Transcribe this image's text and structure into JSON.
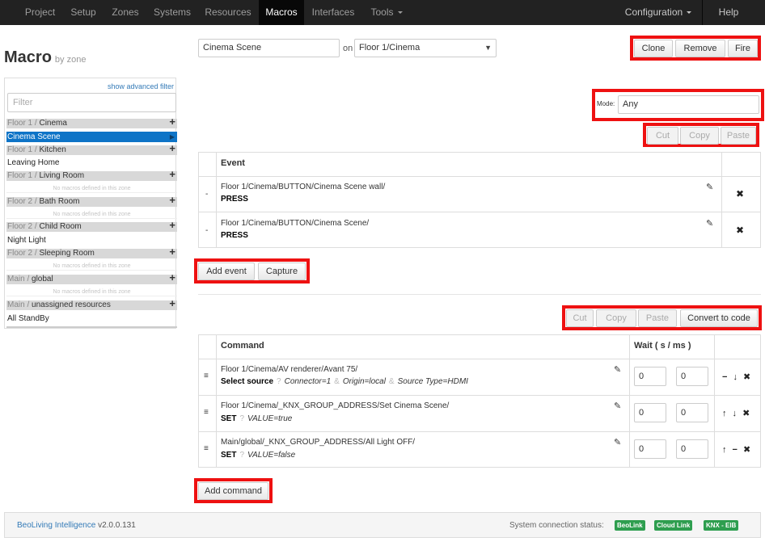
{
  "nav": {
    "items": [
      "Project",
      "Setup",
      "Zones",
      "Systems",
      "Resources",
      "Macros",
      "Interfaces",
      "Tools"
    ],
    "active": "Macros",
    "configuration": "Configuration",
    "help": "Help"
  },
  "page": {
    "title": "Macro",
    "subtitle": "by zone"
  },
  "sidebar": {
    "advanced_filter": "show advanced filter",
    "filter_placeholder": "Filter",
    "zones": [
      {
        "prefix": "Floor 1 / ",
        "name": "Cinema"
      },
      {
        "prefix": "Floor 1 / ",
        "name": "Kitchen"
      },
      {
        "prefix": "Floor 1 / ",
        "name": "Living Room"
      },
      {
        "prefix": "Floor 2 / ",
        "name": "Bath Room"
      },
      {
        "prefix": "Floor 2 / ",
        "name": "Child Room"
      },
      {
        "prefix": "Floor 2 / ",
        "name": "Sleeping Room"
      },
      {
        "prefix": "Main / ",
        "name": "global"
      },
      {
        "prefix": "Main / ",
        "name": "unassigned resources"
      }
    ],
    "macros": [
      "Cinema Scene",
      "Leaving Home",
      "Night Light",
      "All StandBy"
    ],
    "empty_text": "No macros defined in this zone"
  },
  "macro": {
    "name": "Cinema Scene",
    "on_label": "on",
    "zone": "Floor 1/Cinema",
    "clone": "Clone",
    "remove": "Remove",
    "fire": "Fire",
    "mode_label": "Mode:",
    "mode_value": "Any"
  },
  "clipboard": {
    "cut": "Cut",
    "copy": "Copy",
    "paste": "Paste",
    "convert": "Convert to code"
  },
  "events": {
    "header": "Event",
    "rows": [
      {
        "marker": "-",
        "path": "Floor 1/Cinema/BUTTON/Cinema Scene wall/",
        "action": "PRESS"
      },
      {
        "marker": "-",
        "path": "Floor 1/Cinema/BUTTON/Cinema Scene/",
        "action": "PRESS"
      }
    ],
    "add": "Add event",
    "capture": "Capture"
  },
  "commands": {
    "header": "Command",
    "wait_header": "Wait ( s / ms )",
    "rows": [
      {
        "path": "Floor 1/Cinema/AV renderer/Avant 75/",
        "action": "Select source",
        "params": [
          "Connector=1",
          "Origin=local",
          "Source Type=HDMI"
        ],
        "seps": [
          "?",
          "&",
          "&"
        ],
        "wait_s": "0",
        "wait_ms": "0",
        "controls": "− ↓ ✖"
      },
      {
        "path": "Floor 1/Cinema/_KNX_GROUP_ADDRESS/Set Cinema Scene/",
        "action": "SET",
        "params": [
          "VALUE=true"
        ],
        "seps": [
          "?"
        ],
        "wait_s": "0",
        "wait_ms": "0",
        "controls": "↑ ↓ ✖"
      },
      {
        "path": "Main/global/_KNX_GROUP_ADDRESS/All Light OFF/",
        "action": "SET",
        "params": [
          "VALUE=false"
        ],
        "seps": [
          "?"
        ],
        "wait_s": "0",
        "wait_ms": "0",
        "controls": "↑ − ✖"
      }
    ],
    "add": "Add command"
  },
  "footer": {
    "product": "BeoLiving Intelligence",
    "version": "v2.0.0.131",
    "status_label": "System connection status:",
    "badges": [
      "BeoLink",
      "Cloud Link",
      "KNX - EIB"
    ]
  },
  "colors": {
    "highlight": "#ee1111",
    "selected": "#0e74c7",
    "badge": "#2e9e4f",
    "navbar": "#222222"
  }
}
